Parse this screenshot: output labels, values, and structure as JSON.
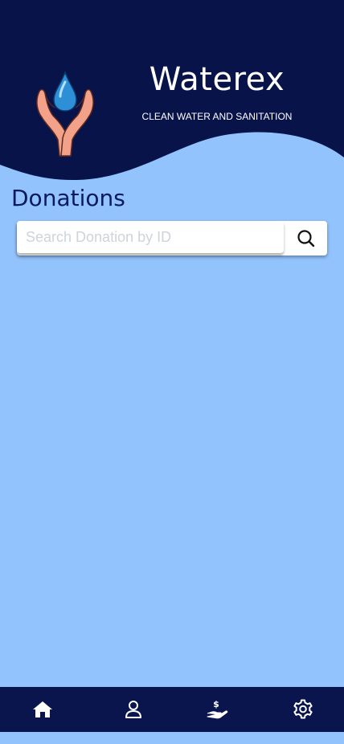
{
  "header": {
    "app_title": "Waterex",
    "app_subtitle": "CLEAN WATER AND SANITATION",
    "logo_icon": "hands-water-drop-logo"
  },
  "main": {
    "page_title": "Donations",
    "search": {
      "placeholder": "Search Donation by ID",
      "value": "",
      "button_icon": "search-icon"
    }
  },
  "bottom_nav": {
    "items": [
      {
        "icon": "home-icon"
      },
      {
        "icon": "profile-icon"
      },
      {
        "icon": "donate-icon"
      },
      {
        "icon": "settings-icon"
      }
    ]
  },
  "colors": {
    "header_bg": "#08134a",
    "page_bg": "#93c3fc",
    "title_text": "#0a1a5c",
    "nav_bg": "#0b154d"
  }
}
